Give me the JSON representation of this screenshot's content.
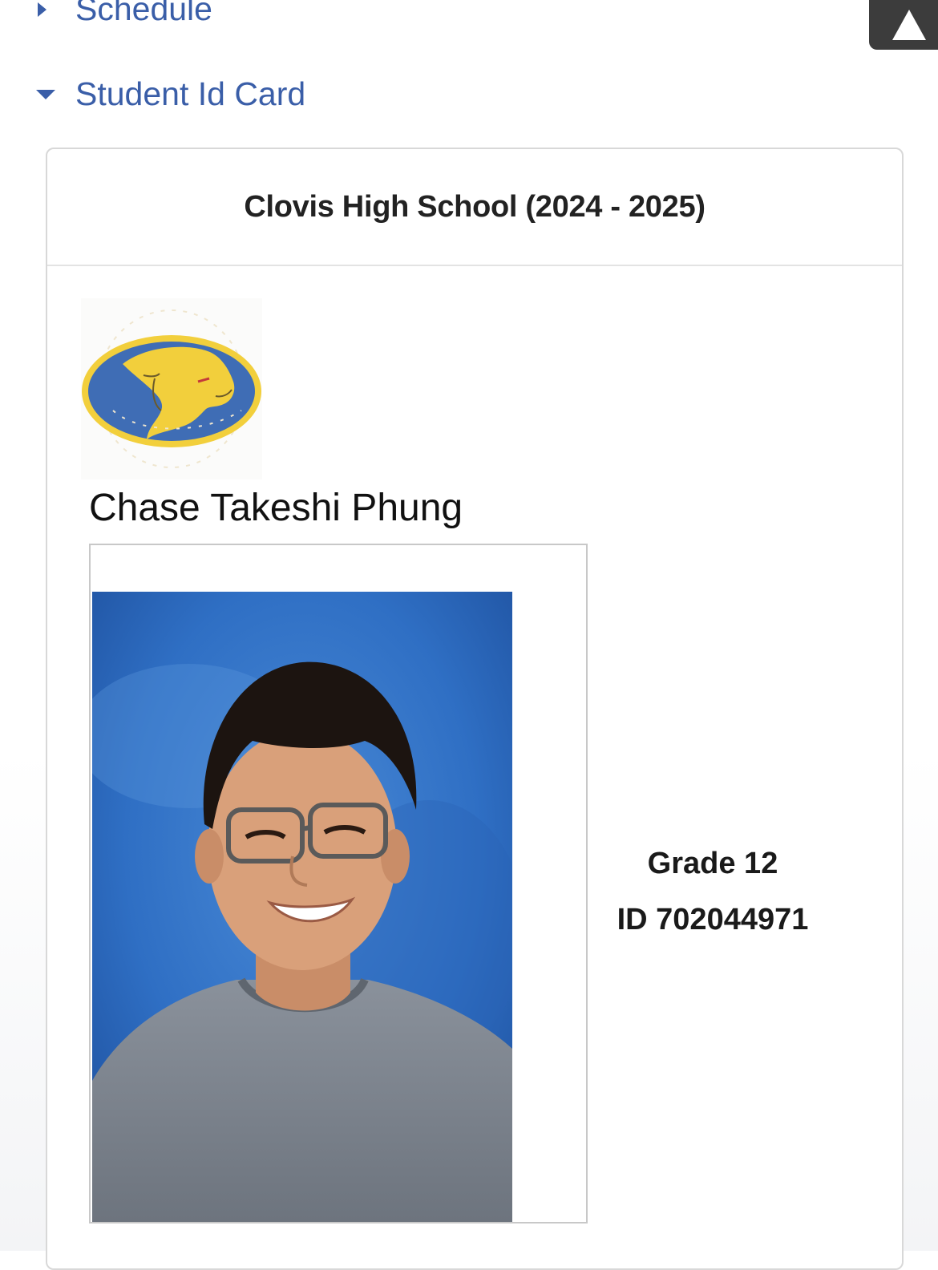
{
  "nav": {
    "schedule_label": "Schedule",
    "student_id_card_label": "Student Id Card"
  },
  "id_card": {
    "school_title": "Clovis High School (2024 - 2025)",
    "student_name": "Chase Takeshi Phung",
    "grade": "Grade 12",
    "student_id": "ID 702044971"
  },
  "colors": {
    "link_blue": "#3a5ea8",
    "logo_blue": "#3f6db5",
    "logo_gold": "#f2cf3c",
    "photo_background": "#2f6fc4",
    "shirt_gray": "#7f8690"
  },
  "icons": {
    "collapsed_caret": "caret-right-icon",
    "expanded_caret": "caret-down-icon",
    "scroll_top": "up-triangle-icon"
  }
}
